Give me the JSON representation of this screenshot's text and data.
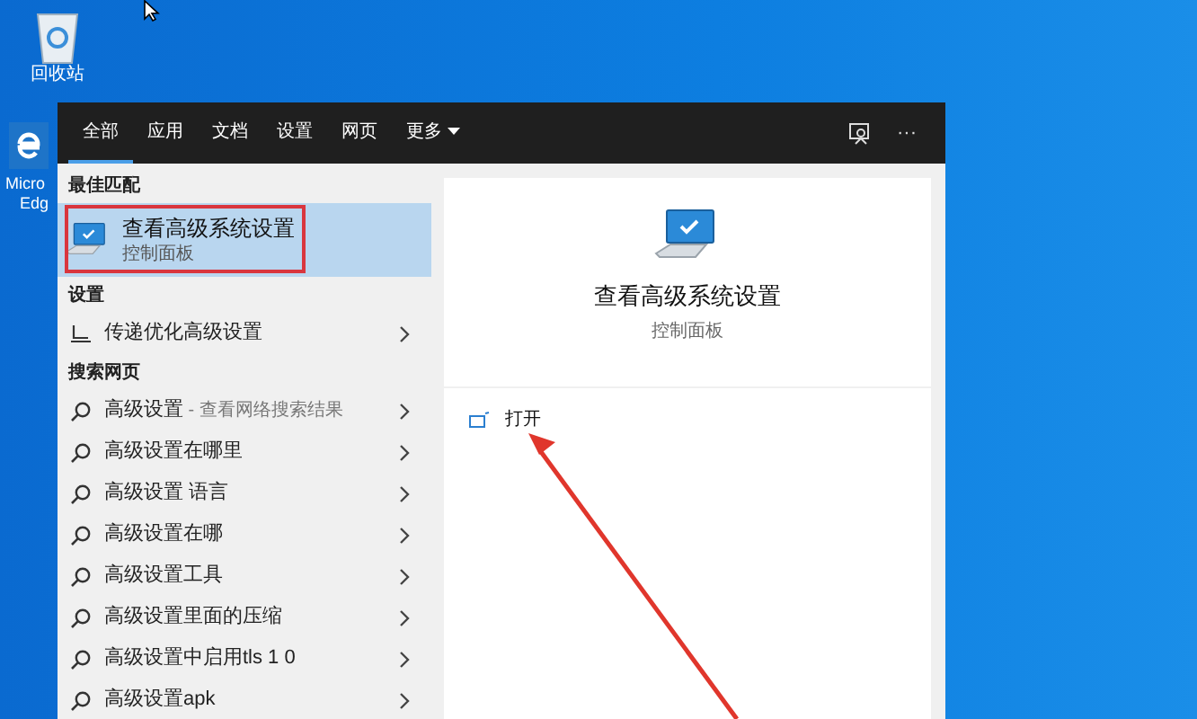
{
  "desktop_icons": [
    {
      "kind": "recycle",
      "label": "回收站"
    },
    {
      "kind": "browser",
      "label": "Micro",
      "label_line2": "Edg"
    }
  ],
  "tabs": [
    {
      "label": "全部",
      "selected": true
    },
    {
      "label": "应用",
      "selected": false
    },
    {
      "label": "文档",
      "selected": false
    },
    {
      "label": "设置",
      "selected": false
    },
    {
      "label": "网页",
      "selected": false
    },
    {
      "label": "更多",
      "selected": false,
      "dropdown": true
    }
  ],
  "header_actions": [
    {
      "kind": "feedback"
    },
    {
      "kind": "more",
      "label": "···"
    }
  ],
  "results": [
    {
      "kind": "header",
      "label": "最佳匹配"
    },
    {
      "kind": "best",
      "title": "查看高级系统设置",
      "subtitle": "控制面板",
      "selected": true
    },
    {
      "kind": "header",
      "label": "设置"
    },
    {
      "kind": "setting",
      "label": "传递优化高级设置"
    },
    {
      "kind": "header",
      "label": "搜索网页"
    },
    {
      "kind": "web",
      "label": "高级设置",
      "hint": " - 查看网络搜索结果"
    },
    {
      "kind": "web",
      "label": "高级设置在哪里"
    },
    {
      "kind": "web",
      "label": "高级设置 语言"
    },
    {
      "kind": "web",
      "label": "高级设置在哪"
    },
    {
      "kind": "web",
      "label": "高级设置工具"
    },
    {
      "kind": "web",
      "label": "高级设置里面的压缩"
    },
    {
      "kind": "web",
      "label": "高级设置中启用tls 1 0"
    },
    {
      "kind": "web",
      "label": "高级设置apk"
    }
  ],
  "preview": {
    "title": "查看高级系统设置",
    "subtitle": "控制面板",
    "actions": [
      {
        "label": "打开"
      }
    ]
  }
}
